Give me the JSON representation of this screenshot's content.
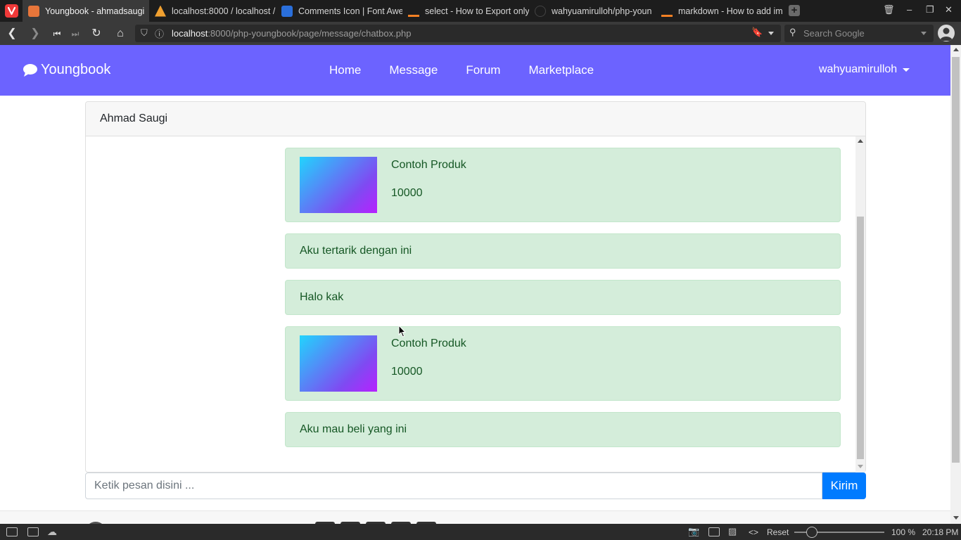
{
  "browser": {
    "tabs": [
      {
        "title": "Youngbook - ahmadsaugi",
        "active": true,
        "favicon_color": "#e8763a"
      },
      {
        "title": "localhost:8000 / localhost /",
        "active": false,
        "favicon_color": "#f0a030"
      },
      {
        "title": "Comments Icon | Font Awe",
        "active": false,
        "favicon_color": "#2a6fdb"
      },
      {
        "title": "select - How to Export only",
        "active": false,
        "favicon_color": "#f48024"
      },
      {
        "title": "wahyuamirulloh/php-youn",
        "active": false,
        "favicon_color": "#1d1d1d"
      },
      {
        "title": "markdown - How to add im",
        "active": false,
        "favicon_color": "#f48024"
      }
    ],
    "url_host": "localhost",
    "url_path": ":8000/php-youngbook/page/message/chatbox.php",
    "search_placeholder": "Search Google",
    "status": {
      "reset_label": "Reset",
      "zoom": "100 %",
      "time": "20:18 PM"
    }
  },
  "navbar": {
    "brand": "Youngbook",
    "links": [
      "Home",
      "Message",
      "Forum",
      "Marketplace"
    ],
    "user": "wahyuamirulloh",
    "bg_color": "#6c63ff"
  },
  "chat": {
    "contact_name": "Ahmad Saugi",
    "messages": [
      {
        "type": "product",
        "product_name": "Contoh Produk",
        "price": "10000"
      },
      {
        "type": "text",
        "text": "Aku tertarik dengan ini"
      },
      {
        "type": "text",
        "text": "Halo kak"
      },
      {
        "type": "product",
        "product_name": "Contoh Produk",
        "price": "10000"
      },
      {
        "type": "text",
        "text": "Aku mau beli yang ini"
      }
    ],
    "input_placeholder": "Ketik pesan disini ...",
    "send_label": "Kirim"
  }
}
